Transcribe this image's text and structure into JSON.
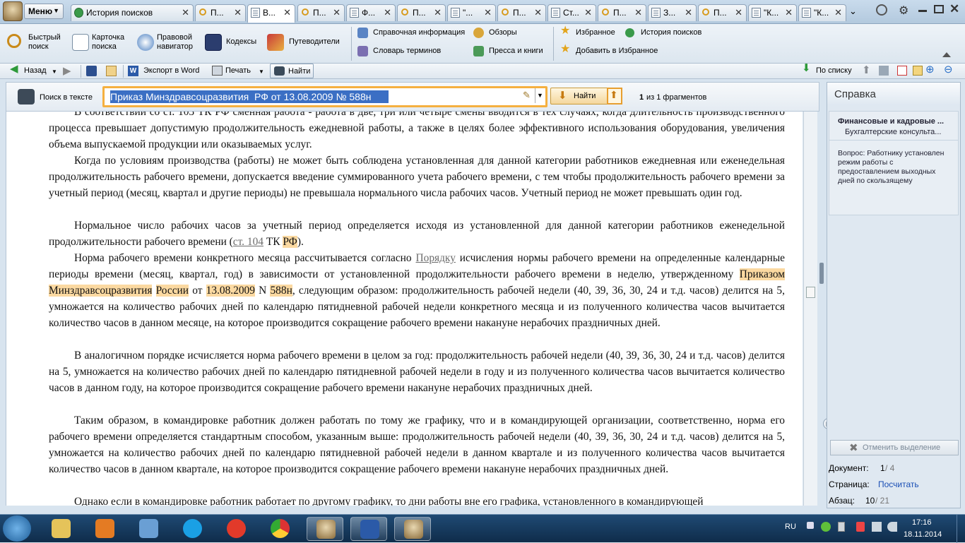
{
  "menu": {
    "label": "Меню"
  },
  "tabs": [
    {
      "label": "История поисков",
      "icon": "history-icon"
    },
    {
      "label": "П...",
      "icon": "search-icon"
    },
    {
      "label": "В...",
      "icon": "document-icon"
    },
    {
      "label": "П...",
      "icon": "search-icon"
    },
    {
      "label": "Ф...",
      "icon": "document-icon"
    },
    {
      "label": "П...",
      "icon": "search-icon"
    },
    {
      "label": "\"...",
      "icon": "document-icon"
    },
    {
      "label": "П...",
      "icon": "search-icon"
    },
    {
      "label": "Ст...",
      "icon": "document-icon"
    },
    {
      "label": "П...",
      "icon": "search-icon"
    },
    {
      "label": "З...",
      "icon": "document-icon"
    },
    {
      "label": "П...",
      "icon": "search-icon"
    },
    {
      "label": "\"К...",
      "icon": "document-icon"
    },
    {
      "label": "\"К...",
      "icon": "document-icon"
    }
  ],
  "toolbar1": {
    "quick_search": "Быстрый\nпоиск",
    "card_search": "Карточка\nпоиска",
    "legal_nav": "Правовой\nнавигатор",
    "codes": "Кодексы",
    "guides": "Путеводители",
    "reference": "Справочная информация",
    "reviews": "Обзоры",
    "glossary": "Словарь терминов",
    "press": "Пресса и книги",
    "favorites": "Избранное",
    "search_history": "История поисков",
    "add_favorites": "Добавить в Избранное"
  },
  "toolbar2": {
    "back": "Назад",
    "export_word": "Экспорт в Word",
    "print": "Печать",
    "find": "Найти",
    "by_list": "По списку"
  },
  "search": {
    "label": "Поиск в тексте",
    "value": "Приказ Минздравсоцразвития  РФ от 13.08.2009 № 588н",
    "find_button": "Найти",
    "count_bold": "1",
    "count_rest": "из 1 фрагментов"
  },
  "doc": {
    "p0": "В соответствии со ст. 103 ТК РФ сменная работа - работа в две, три или четыре смены вводится в тех случаях, когда длительность производственного процесса превышает допустимую продолжительность ежедневной работы, а также в целях более эффективного использования оборудования, увеличения объема выпускаемой продукции или оказываемых услуг.",
    "p1": "Когда по условиям производства (работы) не может быть соблюдена установленная для данной категории работников ежедневная или еженедельная продолжительность рабочего времени, допускается введение суммированного учета рабочего времени, с тем чтобы продолжительность рабочего времени за учетный период (месяц, квартал и другие периоды) не превышала нормального числа рабочих часов. Учетный период не может превышать один год.",
    "p2_a": "Нормальное число рабочих часов за учетный период определяется исходя из установленной для данной категории работников еженедельной продолжительности рабочего времени (",
    "p2_link": "ст. 104",
    "p2_b": " ТК ",
    "p2_hl": "РФ",
    "p2_c": ").",
    "p3_a": "Норма рабочего времени конкретного месяца рассчитывается согласно ",
    "p3_link": "Порядку",
    "p3_b": " исчисления нормы рабочего времени на определенные календарные периоды времени (месяц, квартал, год) в зависимости от установленной продолжительности рабочего времени в неделю, утвержденному ",
    "p3_hl1": "Приказом",
    "p3_hl2": "Минздравсоцразвития",
    "p3_hl3": "России",
    "p3_c": " от ",
    "p3_hl4": "13.08.2009",
    "p3_d": " N ",
    "p3_hl5": "588н",
    "p3_e": ", следующим образом: продолжительность рабочей недели (40, 39, 36, 30, 24 и т.д. часов) делится на 5, умножается на количество рабочих дней по календарю пятидневной рабочей недели конкретного месяца и из полученного количества часов вычитается количество часов в данном месяце, на которое производится сокращение рабочего времени накануне нерабочих праздничных дней.",
    "p4": "В аналогичном порядке исчисляется норма рабочего времени в целом за год: продолжительность рабочей недели (40, 39, 36, 30, 24 и т.д. часов) делится на 5, умножается на количество рабочих дней по календарю пятидневной рабочей недели в году и из полученного количества часов вычитается количество часов в данном году, на которое производится сокращение рабочего времени накануне нерабочих праздничных дней.",
    "p5": "Таким образом, в командировке работник должен работать по тому же графику, что и в командирующей организации, соответственно, норма его рабочего времени определяется стандартным способом, указанным выше: продолжительность рабочей недели (40, 39, 36, 30, 24 и т.д. часов) делится на 5, умножается на количество рабочих дней по календарю пятидневной рабочей недели в данном квартале и из полученного количества часов вычитается количество часов в данном квартале, на которое производится сокращение рабочего времени накануне нерабочих праздничных дней.",
    "p6": "Однако если в командировке работник работает по другому графику, то дни работы вне его графика, установленного в командирующей"
  },
  "sidebar": {
    "title": "Справка",
    "card_title": "Финансовые и кадровые ...",
    "card_sub": "Бухгалтерские консульта...",
    "question": "Вопрос: Работнику установлен режим работы с предоставлением выходных дней по скользящему",
    "clear_sel": "Отменить выделение",
    "doc_label": "Документ:",
    "doc_cur": "1",
    "doc_total": " / 4",
    "page_label": "Страница:",
    "page_link": "Посчитать",
    "para_label": "Абзац:",
    "para_cur": "10",
    "para_total": " / 21"
  },
  "taskbar": {
    "lang": "RU",
    "time": "17:16",
    "date": "18.11.2014"
  }
}
